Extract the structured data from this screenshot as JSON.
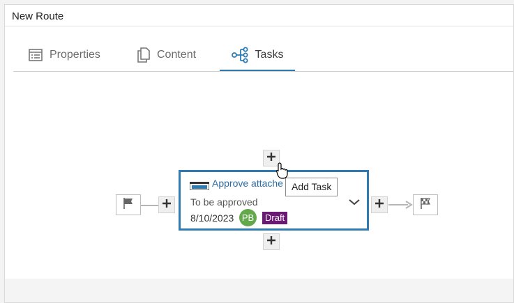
{
  "window": {
    "title": "New Route"
  },
  "tabs": [
    {
      "label": "Properties",
      "icon": "list-icon"
    },
    {
      "label": "Content",
      "icon": "copy-icon"
    },
    {
      "label": "Tasks",
      "icon": "tasks-icon",
      "active": true
    }
  ],
  "route": {
    "start_icon": "flag-icon",
    "end_icon": "checkered-flag-icon",
    "task": {
      "title": "Approve attache",
      "subtitle": "To be approved",
      "due_date": "8/10/2023",
      "assignee_initials": "PB",
      "status": "Draft"
    }
  },
  "tooltip": {
    "text": "Add Task"
  },
  "colors": {
    "accent": "#2f7ab0",
    "status_draft": "#6b1a73",
    "avatar": "#63a84a"
  }
}
